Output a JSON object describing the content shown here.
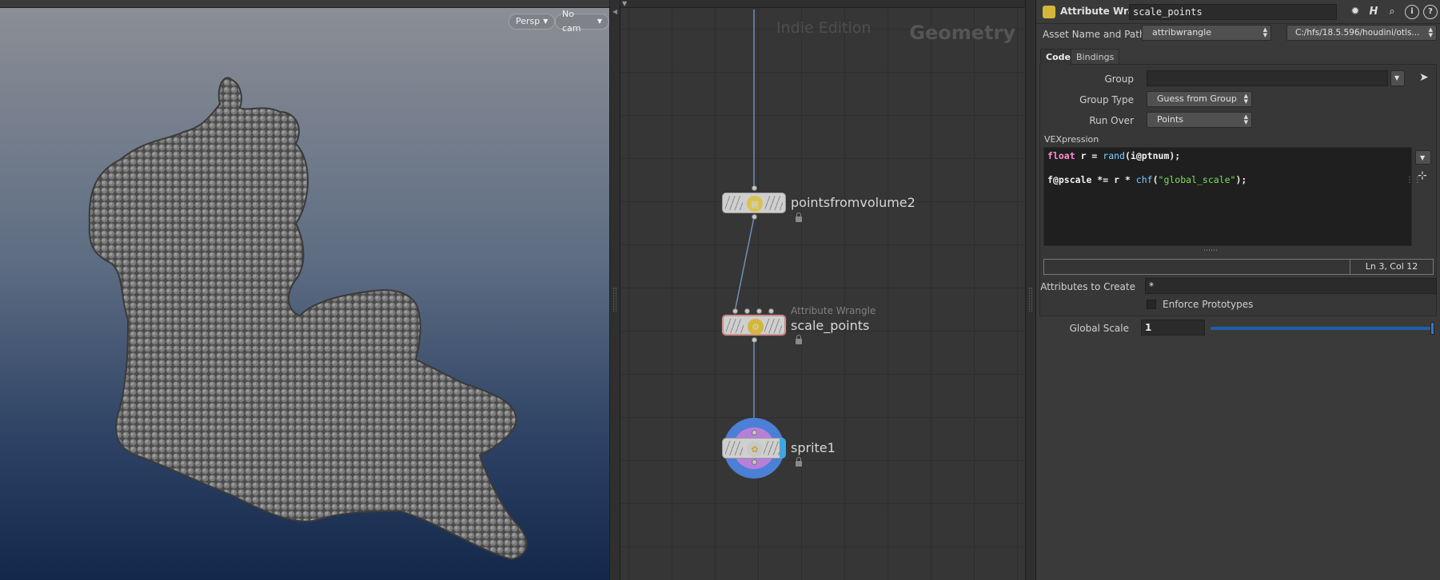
{
  "viewport": {
    "camera_menu": "Persp",
    "cam_menu": "No cam"
  },
  "network": {
    "watermark": "Indie Edition",
    "context": "Geometry",
    "nodes": [
      {
        "name": "pointsfromvolume2",
        "type": ""
      },
      {
        "name": "scale_points",
        "type": "Attribute Wrangle"
      },
      {
        "name": "sprite1",
        "type": ""
      }
    ]
  },
  "params": {
    "op_type": "Attribute Wrangle",
    "node_name": "scale_points",
    "asset_label": "Asset Name and Path",
    "asset_name": "attribwrangle",
    "asset_path": "C:/hfs/18.5.596/houdini/otls...",
    "tabs": [
      "Code",
      "Bindings"
    ],
    "group_label": "Group",
    "group_value": "",
    "group_type_label": "Group Type",
    "group_type_value": "Guess from Group",
    "run_over_label": "Run Over",
    "run_over_value": "Points",
    "vex_label": "VEXpression",
    "code_lines": [
      "float r = rand(i@ptnum);",
      "",
      "f@pscale *= r * chf(\"global_scale\");"
    ],
    "cursor_pos": "Ln 3, Col 12",
    "attrs_label": "Attributes to Create",
    "attrs_value": "*",
    "enforce_label": "Enforce Prototypes",
    "enforce_checked": false,
    "global_scale_label": "Global Scale",
    "global_scale_value": "1",
    "global_scale_fill": 1.0
  },
  "colors": {
    "slider": "#1f5faa",
    "selected_node": "#c88f8f",
    "keyword": "#ff8cd7",
    "function": "#7ecfff",
    "string": "#7de05b"
  }
}
